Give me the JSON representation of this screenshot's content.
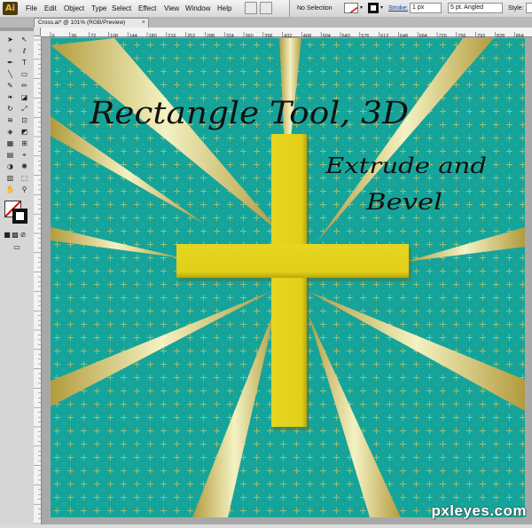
{
  "app": {
    "logo_text": "Ai",
    "menus": [
      "File",
      "Edit",
      "Object",
      "Type",
      "Select",
      "Effect",
      "View",
      "Window",
      "Help"
    ]
  },
  "control_bar": {
    "selection_text": "No Selection",
    "stroke_label": "Stroke:",
    "stroke_weight": "1 px",
    "brush_value": "5 pt. Angled",
    "style_label": "Style:"
  },
  "document": {
    "tab_title": "Cross.ai* @ 101% (RGB/Preview)",
    "tab_close": "×"
  },
  "ruler": {
    "ticks": [
      "0",
      "36",
      "72",
      "108",
      "144",
      "180",
      "216",
      "252",
      "288",
      "324",
      "360",
      "396",
      "432",
      "468",
      "504",
      "540",
      "576",
      "612",
      "648",
      "684",
      "720",
      "756",
      "792",
      "828",
      "864"
    ]
  },
  "artwork": {
    "line1": "Rectangle Tool, 3D",
    "line2": "Extrude and",
    "line3": "Bevel",
    "background_color": "#16a49a",
    "cross_color": "#e2d11e",
    "ray_color": "#f0e8a0"
  },
  "watermark": "pxleyes.com"
}
